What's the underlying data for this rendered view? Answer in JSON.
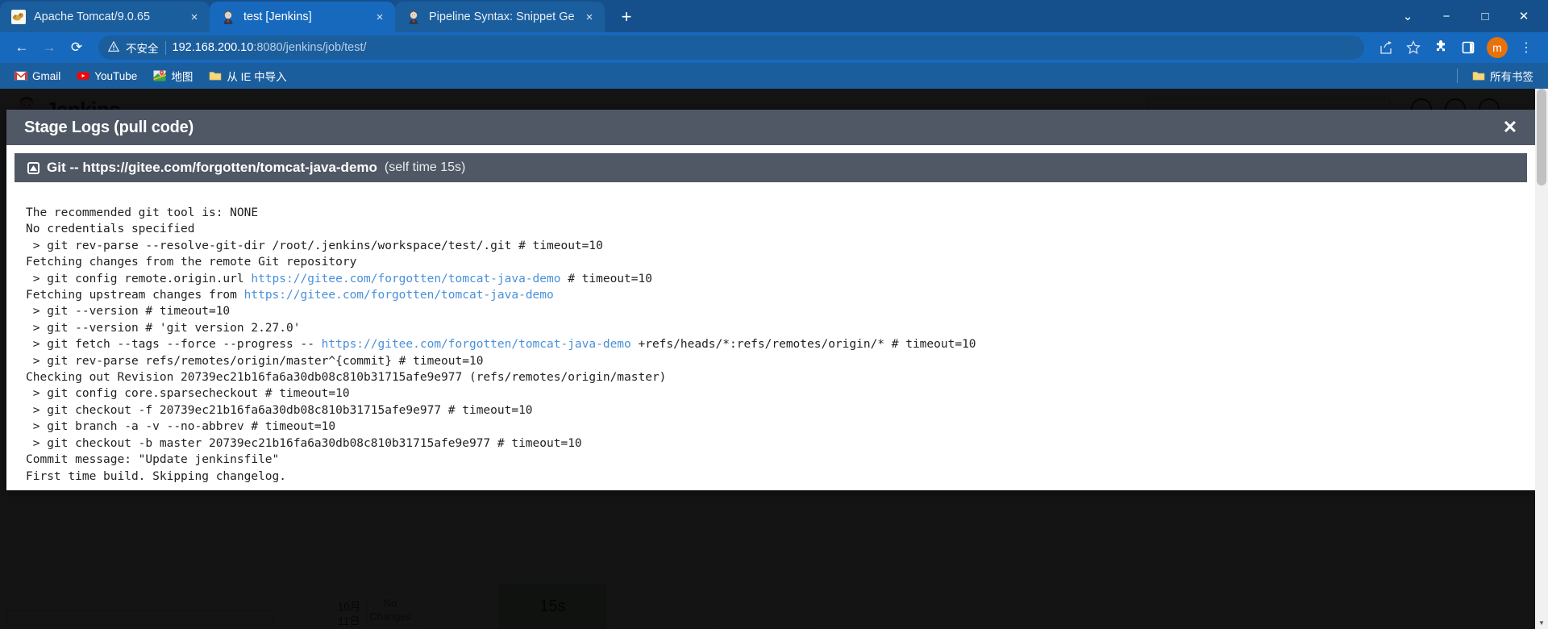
{
  "browser": {
    "tabs": [
      {
        "title": "Apache Tomcat/9.0.65",
        "favicon": "tomcat-icon",
        "active": false,
        "close_label": "×"
      },
      {
        "title": "test [Jenkins]",
        "favicon": "jenkins-icon",
        "active": true,
        "close_label": "×"
      },
      {
        "title": "Pipeline Syntax: Snippet Gene",
        "favicon": "jenkins-icon",
        "active": false,
        "close_label": "×"
      }
    ],
    "new_tab_label": "+",
    "window_controls": {
      "minimize": "−",
      "maximize": "□",
      "close": "✕",
      "more_tabs": "⌄"
    },
    "nav": {
      "back": "←",
      "forward": "→",
      "reload": "⟳"
    },
    "omnibox": {
      "warning_icon": "warning-triangle-icon",
      "warning_text": "不安全",
      "url_host": "192.168.200.10",
      "url_path": ":8080/jenkins/job/test/"
    },
    "toolbar_icons": {
      "share": "share-icon",
      "bookmark": "star-icon",
      "extensions": "puzzle-icon",
      "sidepanel": "sidepanel-icon",
      "profile_initial": "m",
      "menu": "⋮"
    },
    "bookmarks": [
      {
        "label": "Gmail",
        "icon": "gmail-icon"
      },
      {
        "label": "YouTube",
        "icon": "youtube-icon"
      },
      {
        "label": "地图",
        "icon": "maps-icon"
      },
      {
        "label": "从 IE 中导入",
        "icon": "folder-icon"
      }
    ],
    "bookmarks_overflow": {
      "label": "所有书签",
      "icon": "folder-icon"
    }
  },
  "page": {
    "jenkins_word": "Jenkins",
    "stage_view": {
      "date_line1": "10月",
      "date_line2": "11日",
      "no_changes": "No Changes",
      "duration": "15s"
    }
  },
  "modal": {
    "title": "Stage Logs (pull code)",
    "close_label": "✕",
    "section": {
      "collapse_icon": "collapse-triangle-icon",
      "title": "Git -- https://gitee.com/forgotten/tomcat-java-demo",
      "subtitle": "(self time 15s)"
    },
    "log_lines": [
      {
        "text": "The recommended git tool is: NONE"
      },
      {
        "text": "No credentials specified"
      },
      {
        "text": " > git rev-parse --resolve-git-dir /root/.jenkins/workspace/test/.git # timeout=10"
      },
      {
        "text": "Fetching changes from the remote Git repository"
      },
      {
        "text": " > git config remote.origin.url ",
        "link": "https://gitee.com/forgotten/tomcat-java-demo",
        "tail": " # timeout=10"
      },
      {
        "text": "Fetching upstream changes from ",
        "link": "https://gitee.com/forgotten/tomcat-java-demo",
        "tail": ""
      },
      {
        "text": " > git --version # timeout=10"
      },
      {
        "text": " > git --version # 'git version 2.27.0'"
      },
      {
        "text": " > git fetch --tags --force --progress -- ",
        "link": "https://gitee.com/forgotten/tomcat-java-demo",
        "tail": " +refs/heads/*:refs/remotes/origin/* # timeout=10"
      },
      {
        "text": " > git rev-parse refs/remotes/origin/master^{commit} # timeout=10"
      },
      {
        "text": "Checking out Revision 20739ec21b16fa6a30db08c810b31715afe9e977 (refs/remotes/origin/master)"
      },
      {
        "text": " > git config core.sparsecheckout # timeout=10"
      },
      {
        "text": " > git checkout -f 20739ec21b16fa6a30db08c810b31715afe9e977 # timeout=10"
      },
      {
        "text": " > git branch -a -v --no-abbrev # timeout=10"
      },
      {
        "text": " > git checkout -b master 20739ec21b16fa6a30db08c810b31715afe9e977 # timeout=10"
      },
      {
        "text": "Commit message: \"Update jenkinsfile\""
      },
      {
        "text": "First time build. Skipping changelog."
      }
    ]
  },
  "colors": {
    "chrome_blue": "#15508c",
    "chrome_toolbar": "#1769bd",
    "modal_header": "#4f5864",
    "link_blue": "#4a90d9",
    "stage_green": "#c8e6c9",
    "avatar_orange": "#e8710a"
  }
}
